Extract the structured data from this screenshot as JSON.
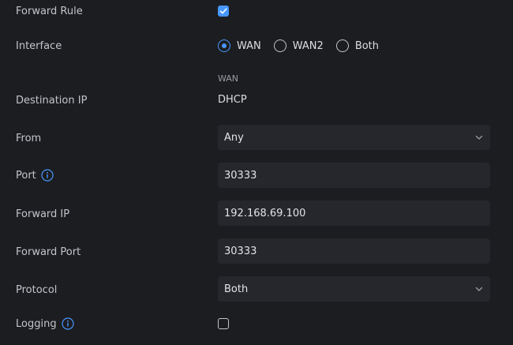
{
  "forward_rule": {
    "label": "Forward Rule",
    "checked": true
  },
  "interface": {
    "label": "Interface",
    "options": [
      "WAN",
      "WAN2",
      "Both"
    ],
    "selected": "WAN"
  },
  "destination_ip": {
    "label": "Destination IP",
    "caption": "WAN",
    "value": "DHCP"
  },
  "from": {
    "label": "From",
    "value": "Any"
  },
  "port": {
    "label": "Port",
    "value": "30333"
  },
  "forward_ip": {
    "label": "Forward IP",
    "value": "192.168.69.100"
  },
  "forward_port": {
    "label": "Forward Port",
    "value": "30333"
  },
  "protocol": {
    "label": "Protocol",
    "value": "Both"
  },
  "logging": {
    "label": "Logging",
    "checked": false
  },
  "colors": {
    "background": "#1c1d21",
    "field": "#26272c",
    "accent": "#4797ff",
    "label": "#c3c5ca"
  },
  "icons": {
    "info": "info-icon",
    "chevron": "chevron-down-icon",
    "check": "checkmark-icon"
  }
}
